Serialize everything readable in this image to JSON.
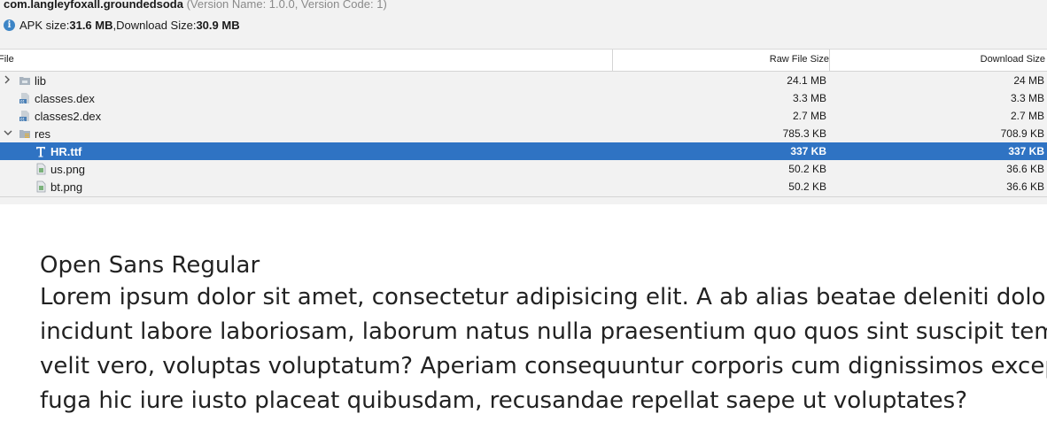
{
  "header": {
    "package_name": "com.langleyfoxall.groundedsoda",
    "version_info": " (Version Name: 1.0.0, Version Code: 1)",
    "apk_size_label": "APK size: ",
    "apk_size_value": "31.6 MB",
    "separator": ", ",
    "download_size_label": "Download Size: ",
    "download_size_value": "30.9 MB",
    "info_icon": "info-icon"
  },
  "table": {
    "columns": {
      "file": "File",
      "raw": "Raw File Size",
      "download": "Download Size"
    },
    "rows": [
      {
        "name": "lib",
        "raw": "24.1 MB",
        "download": "24 MB",
        "icon": "folder-icon",
        "expander": "collapsed"
      },
      {
        "name": "classes.dex",
        "raw": "3.3 MB",
        "download": "3.3 MB",
        "icon": "dex-file-icon"
      },
      {
        "name": "classes2.dex",
        "raw": "2.7 MB",
        "download": "2.7 MB",
        "icon": "dex-file-icon"
      },
      {
        "name": "res",
        "raw": "785.3 KB",
        "download": "708.9 KB",
        "icon": "resource-folder-icon",
        "expander": "expanded"
      },
      {
        "name": "HR.ttf",
        "raw": "337 KB",
        "download": "337 KB",
        "icon": "font-file-icon",
        "selected": true
      },
      {
        "name": "us.png",
        "raw": "50.2 KB",
        "download": "36.6 KB",
        "icon": "image-file-icon"
      },
      {
        "name": "bt.png",
        "raw": "50.2 KB",
        "download": "36.6 KB",
        "icon": "image-file-icon"
      }
    ],
    "selection_color": "#2f73c3"
  },
  "preview": {
    "font_name": "Open Sans Regular",
    "lines": [
      "Lorem ipsum dolor sit amet, consectetur adipisicing elit. A ab alias beatae deleniti dolore",
      "incidunt labore laboriosam, laborum natus nulla praesentium quo quos sint suscipit tem",
      "velit vero, voluptas voluptatum? Aperiam consequuntur corporis cum dignissimos excep",
      "fuga hic iure iusto placeat quibusdam, recusandae repellat saepe ut voluptates?"
    ]
  }
}
